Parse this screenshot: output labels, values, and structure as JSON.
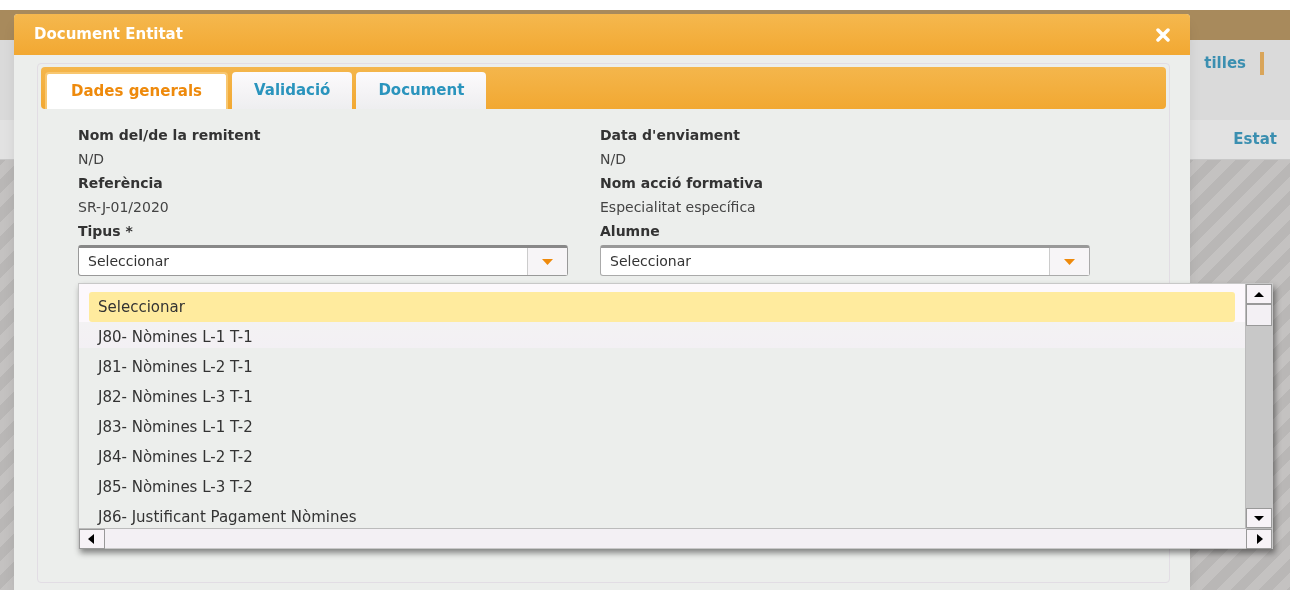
{
  "background_page": {
    "tab_label": "tilles",
    "column_header": "Estat"
  },
  "dialog": {
    "title": "Document Entitat"
  },
  "tabs": [
    {
      "label": "Dades generals",
      "selected": true
    },
    {
      "label": "Validació",
      "selected": false
    },
    {
      "label": "Document",
      "selected": false
    }
  ],
  "columns": [
    [
      {
        "kind": "text",
        "label": "Nom del/de la remitent",
        "value": "N/D"
      },
      {
        "kind": "text",
        "label": "Referència",
        "value": "SR-J-01/2020"
      },
      {
        "kind": "select",
        "label": "Tipus *",
        "value": "Seleccionar",
        "open": true
      }
    ],
    [
      {
        "kind": "text",
        "label": "Data d'enviament",
        "value": "N/D"
      },
      {
        "kind": "text",
        "label": "Nom acció formativa",
        "value": "Especialitat específica"
      },
      {
        "kind": "select",
        "label": "Alumne",
        "value": "Seleccionar",
        "open": false
      }
    ]
  ],
  "dropdown_options": [
    {
      "label": "Seleccionar",
      "selected": true
    },
    {
      "label": "J80- Nòmines L-1 T-1",
      "selected": false
    },
    {
      "label": "J81- Nòmines L-2 T-1",
      "selected": false
    },
    {
      "label": "J82- Nòmines L-3 T-1",
      "selected": false
    },
    {
      "label": "J83- Nòmines L-1 T-2",
      "selected": false
    },
    {
      "label": "J84- Nòmines L-2 T-2",
      "selected": false
    },
    {
      "label": "J85- Nòmines L-3 T-2",
      "selected": false
    },
    {
      "label": "J86- Justificant Pagament Nòmines",
      "selected": false
    }
  ]
}
